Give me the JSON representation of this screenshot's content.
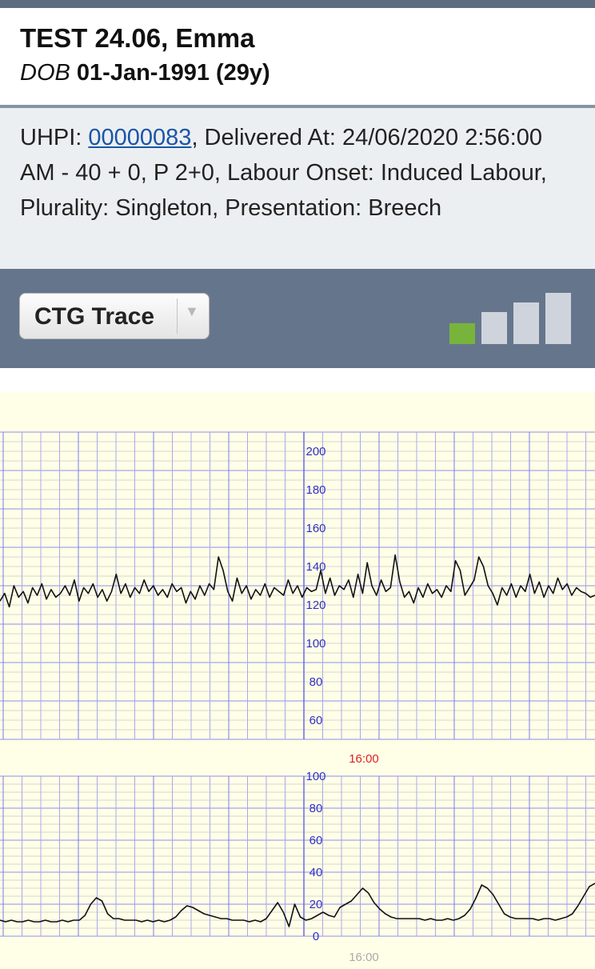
{
  "patient": {
    "name": "TEST 24.06, Emma",
    "dob_label": "DOB",
    "dob_value": "01-Jan-1991 (29y)"
  },
  "details": {
    "uhpi_label": "UHPI: ",
    "uhpi_link": "00000083",
    "rest": ", Delivered At: 24/06/2020 2:56:00 AM - 40 + 0, P 2+0, Labour Onset: Induced Labour, Plurality: Singleton, Presentation: Breech"
  },
  "toolbar": {
    "view_select_value": "CTG Trace",
    "signal_level": 1,
    "signal_bars": 4,
    "colors": {
      "active": "#78b43c",
      "inactive": "#cfd4dc"
    }
  },
  "chart_data": [
    {
      "type": "line",
      "name": "fhr",
      "ylim": [
        50,
        210
      ],
      "y_ticks": [
        "200",
        "180",
        "160",
        "140",
        "120",
        "100",
        "80",
        "60"
      ],
      "x_center_label": "16:00",
      "series": [
        {
          "y": [
            122,
            126,
            119,
            130,
            124,
            127,
            121,
            129,
            125,
            131,
            123,
            128,
            124,
            126,
            130,
            125,
            133,
            122,
            129,
            126,
            131,
            124,
            128,
            122,
            127,
            136,
            126,
            131,
            124,
            129,
            126,
            133,
            127,
            130,
            125,
            128,
            124,
            131,
            127,
            129,
            121,
            127,
            123,
            130,
            125,
            131,
            128,
            145,
            138,
            127,
            122,
            134,
            126,
            130,
            123,
            128,
            125,
            131,
            124,
            129,
            127,
            125,
            133,
            126,
            130,
            124,
            129,
            127,
            128,
            138,
            126,
            134,
            125,
            130,
            128,
            133,
            124,
            136,
            126,
            142,
            130,
            125,
            133,
            127,
            129,
            146,
            132,
            124,
            127,
            121,
            129,
            124,
            131,
            126,
            128,
            124,
            130,
            127,
            143,
            138,
            125,
            129,
            133,
            145,
            140,
            130,
            126,
            120,
            129,
            125,
            131,
            124,
            130,
            127,
            136,
            126,
            132,
            124,
            130,
            126,
            134,
            128,
            131,
            125,
            129,
            127,
            126,
            124,
            125
          ]
        }
      ]
    },
    {
      "type": "line",
      "name": "toco",
      "ylim": [
        0,
        100
      ],
      "y_ticks": [
        "100",
        "80",
        "60",
        "40",
        "20",
        "0"
      ],
      "x_center_label": "16:00",
      "series": [
        {
          "y": [
            10,
            9,
            10,
            9,
            9,
            10,
            9,
            9,
            10,
            9,
            9,
            10,
            9,
            10,
            10,
            13,
            20,
            24,
            22,
            14,
            11,
            11,
            10,
            10,
            10,
            9,
            10,
            9,
            10,
            9,
            10,
            12,
            16,
            19,
            18,
            16,
            14,
            13,
            12,
            11,
            11,
            10,
            10,
            10,
            9,
            10,
            9,
            11,
            16,
            21,
            15,
            6,
            20,
            12,
            10,
            11,
            13,
            15,
            13,
            12,
            18,
            20,
            22,
            26,
            30,
            27,
            21,
            17,
            14,
            12,
            11,
            11,
            11,
            11,
            11,
            10,
            11,
            10,
            10,
            11,
            10,
            11,
            13,
            17,
            24,
            32,
            30,
            26,
            20,
            14,
            12,
            11,
            11,
            11,
            11,
            10,
            11,
            11,
            10,
            11,
            12,
            14,
            19,
            25,
            31,
            33
          ]
        }
      ]
    }
  ]
}
